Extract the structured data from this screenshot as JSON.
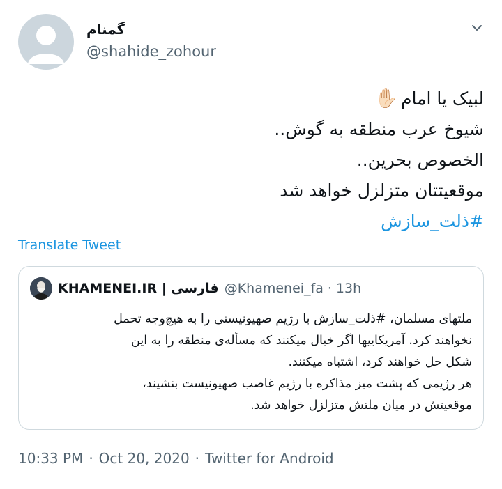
{
  "tweet": {
    "display_name": "گمنام",
    "handle": "@shahide_zohour",
    "lines": [
      "لبیک یا امام",
      "شیوخ عرب منطقه به گوش..",
      "الخصوص بحرین..",
      "موقعیتتان متزلزل خواهد شد"
    ],
    "wave_emoji": "✋🏻",
    "hashtag": "#ذلت_سازش",
    "translate_label": "Translate Tweet"
  },
  "quoted": {
    "name": "KHAMENEI.IR | فارسی",
    "handle": "@Khamenei_fa",
    "separator": "·",
    "time": "13h",
    "text_lines": [
      "ملتهای مسلمان، #ذلت_سازش با رژیم صهیونیستی را به هیچ‌وجه تحمل",
      "نخواهند کرد. آمریکاییها اگر خیال میکنند که مسأله‌ی منطقه را به این",
      "شکل حل خواهند کرد، اشتباه میکنند.",
      "هر رژیمی که پشت میز مذاکره با رژیم غاصب صهیونیست بنشیند،",
      "موقعیتش در میان ملتش متزلزل خواهد شد."
    ]
  },
  "meta": {
    "time": "10:33 PM",
    "dot": "·",
    "date": "Oct 20, 2020",
    "app": "Twitter for Android"
  },
  "icons": {
    "caret": "chevron-down-icon",
    "avatar": "default-avatar-icon"
  },
  "colors": {
    "link": "#1b95e0",
    "secondary_text": "#536471",
    "border": "#cfd9de"
  }
}
